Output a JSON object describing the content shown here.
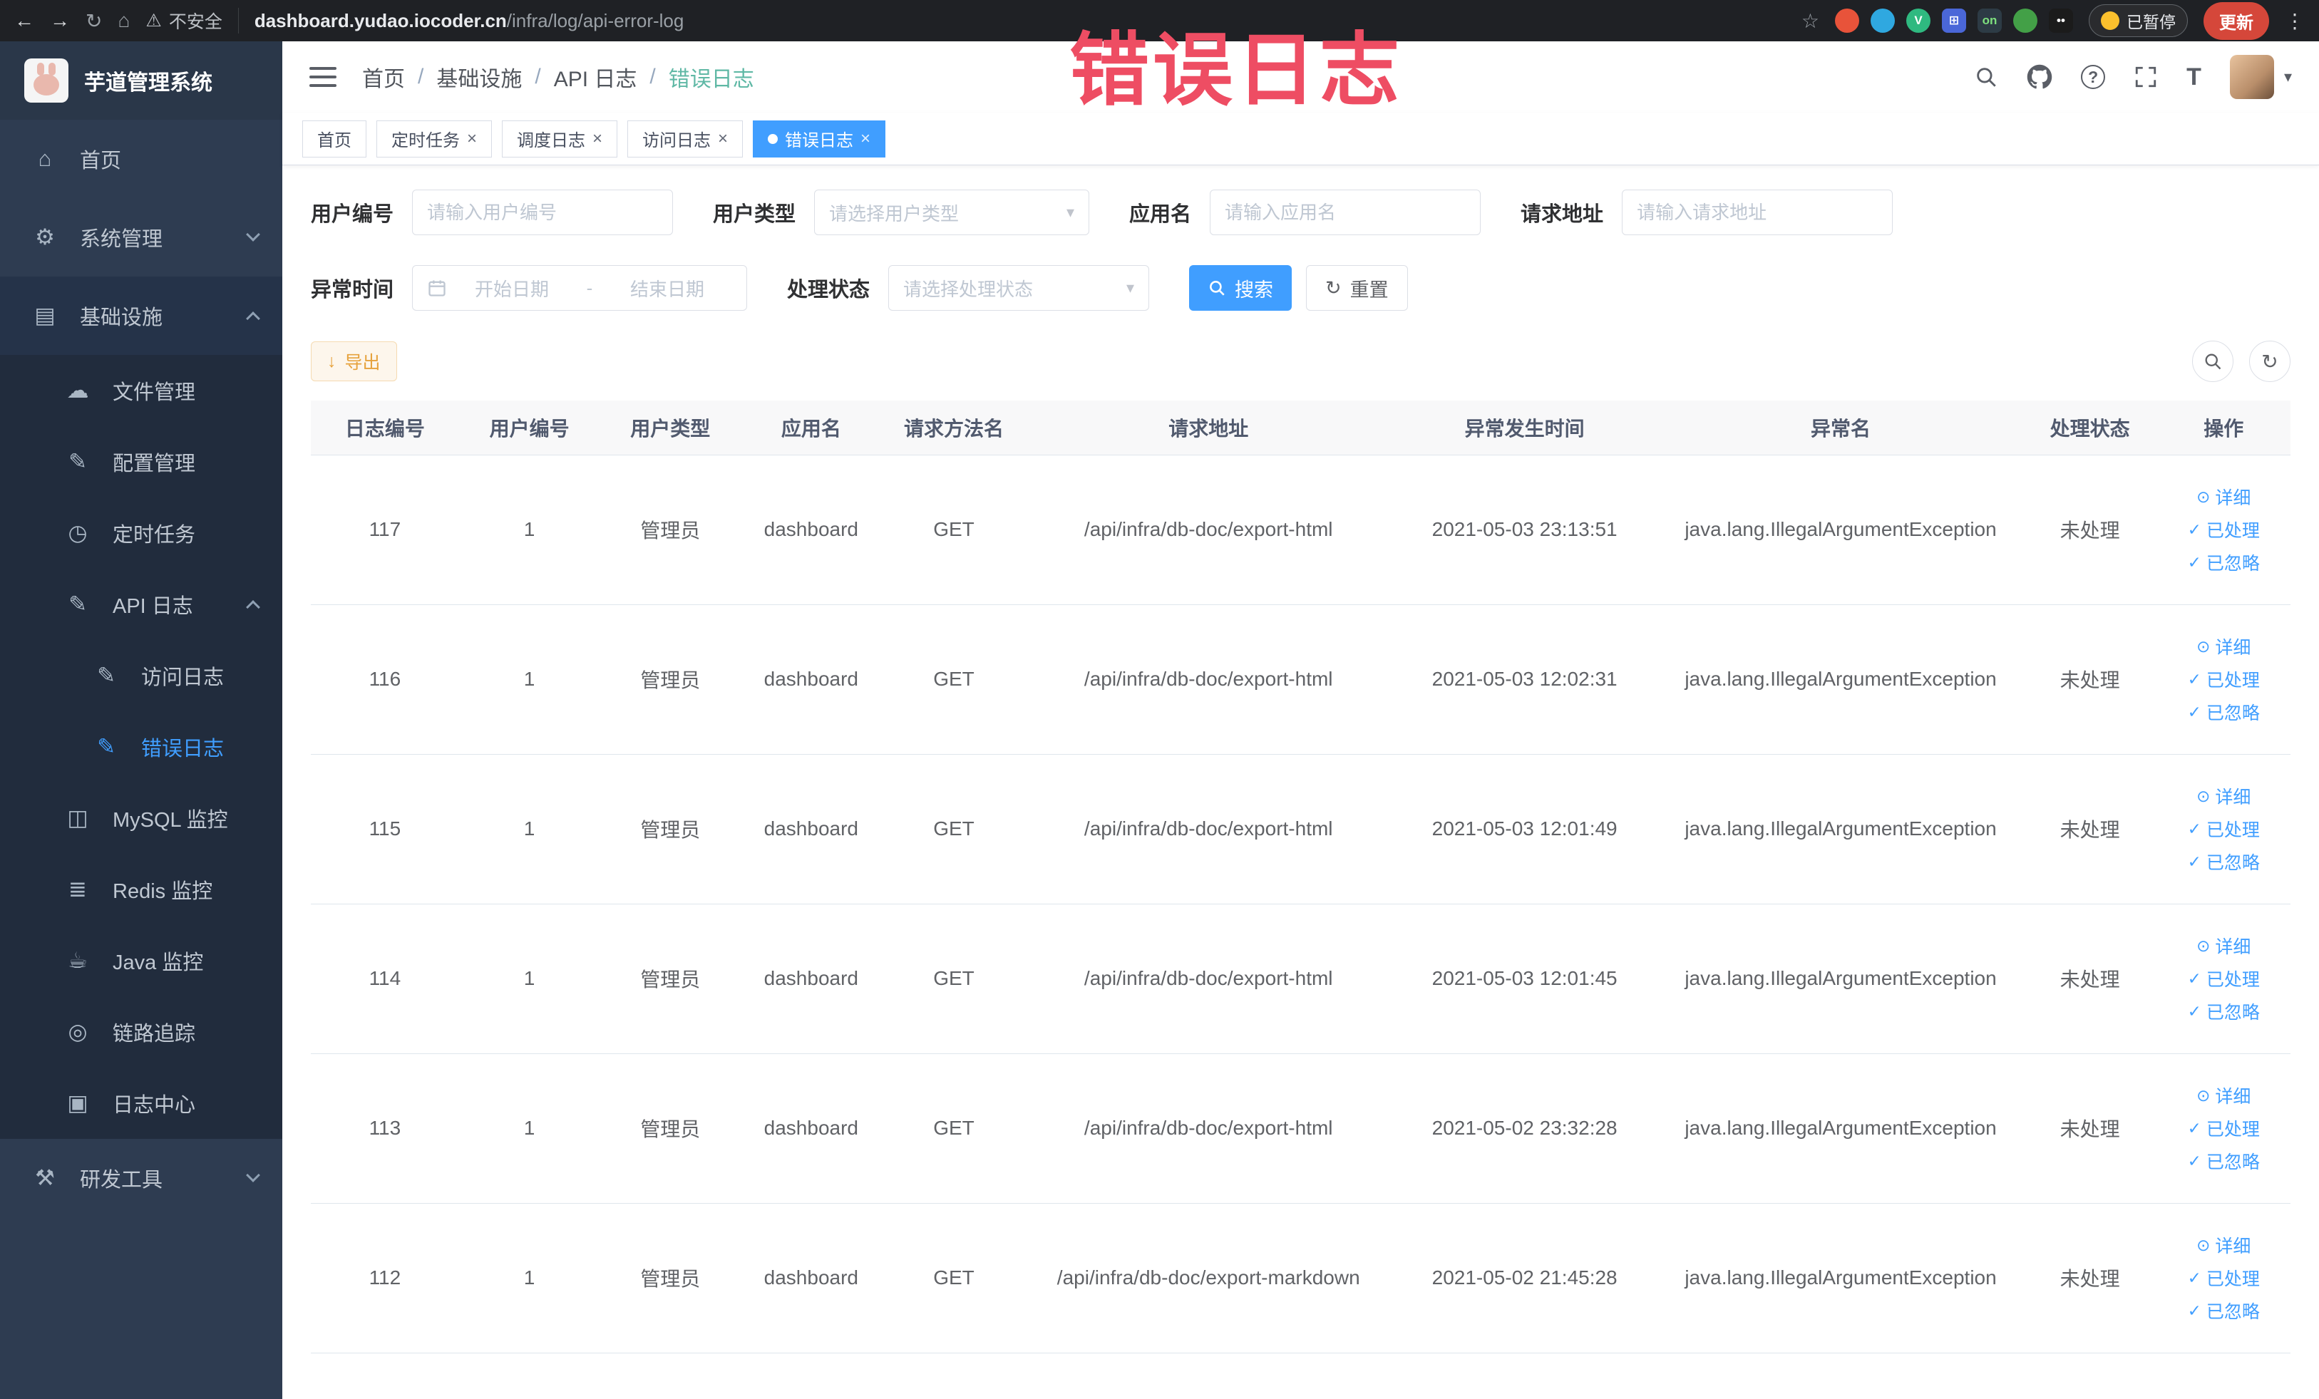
{
  "annotation": {
    "text": "错误日志"
  },
  "browser": {
    "security_label": "不安全",
    "url_domain": "dashboard.yudao.iocoder.cn",
    "url_path": "/infra/log/api-error-log",
    "paused_label": "已暂停",
    "update_label": "更新",
    "extensions": [
      {
        "name": "orange-extension-icon",
        "shape": "circle",
        "bg": "#e8533a",
        "glyph": ""
      },
      {
        "name": "water-drop-extension-icon",
        "shape": "circle",
        "bg": "#2fa8e0",
        "glyph": ""
      },
      {
        "name": "vue-devtools-extension-icon",
        "shape": "circle",
        "bg": "#2fb980",
        "glyph": "V"
      },
      {
        "name": "grid-extension-icon",
        "shape": "square",
        "bg": "#4a67d8",
        "glyph": "⊞"
      },
      {
        "name": "switchy-on-extension-icon",
        "shape": "square",
        "bg": "#2d3b45",
        "glyph": "on",
        "glyph_color": "#7ee07e"
      },
      {
        "name": "leaf-extension-icon",
        "shape": "circle",
        "bg": "#43a047",
        "glyph": ""
      },
      {
        "name": "tampermonkey-extension-icon",
        "shape": "square",
        "bg": "#1b1b1b",
        "glyph": "••"
      }
    ]
  },
  "sidebar": {
    "title": "芋道管理系统",
    "items": [
      {
        "key": "home",
        "label": "首页",
        "icon": "home",
        "level": 1
      },
      {
        "key": "system",
        "label": "系统管理",
        "icon": "gear",
        "level": 1,
        "arrow": "down"
      },
      {
        "key": "infra",
        "label": "基础设施",
        "icon": "infra",
        "level": 1,
        "arrow": "up",
        "open": true
      },
      {
        "key": "file",
        "label": "文件管理",
        "icon": "cloud",
        "level": 2
      },
      {
        "key": "config",
        "label": "配置管理",
        "icon": "edit",
        "level": 2
      },
      {
        "key": "job",
        "label": "定时任务",
        "icon": "clock",
        "level": 2
      },
      {
        "key": "api-log",
        "label": "API 日志",
        "icon": "note",
        "level": 2,
        "arrow": "up",
        "open": true
      },
      {
        "key": "access-log",
        "label": "访问日志",
        "icon": "note",
        "level": 3
      },
      {
        "key": "error-log",
        "label": "错误日志",
        "icon": "note",
        "level": 3,
        "active": true
      },
      {
        "key": "mysql",
        "label": "MySQL 监控",
        "icon": "monitor",
        "level": 2
      },
      {
        "key": "redis",
        "label": "Redis 监控",
        "icon": "db",
        "level": 2
      },
      {
        "key": "java",
        "label": "Java 监控",
        "icon": "coffee",
        "level": 2
      },
      {
        "key": "trace",
        "label": "链路追踪",
        "icon": "eye",
        "level": 2
      },
      {
        "key": "log-center",
        "label": "日志中心",
        "icon": "logcenter",
        "level": 2
      },
      {
        "key": "devtools",
        "label": "研发工具",
        "icon": "tools",
        "level": 1,
        "arrow": "down"
      }
    ]
  },
  "icons": {
    "back": "←",
    "forward": "→",
    "reload": "↻",
    "home": "⌂",
    "warning": "⚠",
    "star": "☆",
    "kebab": "⋮",
    "gear": "⚙",
    "infra": "▤",
    "cloud": "☁",
    "edit": "✎",
    "clock": "◷",
    "note": "✎",
    "monitor": "◫",
    "db": "≣",
    "coffee": "☕",
    "eye": "◎",
    "logcenter": "▣",
    "tools": "⚒",
    "question": "?",
    "fontsize": "T",
    "eye-action": "⊙",
    "check": "✓",
    "download": "↓",
    "refresh": "↻",
    "close": "×"
  },
  "header": {
    "breadcrumb": [
      "首页",
      "基础设施",
      "API 日志",
      "错误日志"
    ]
  },
  "tabs": [
    {
      "label": "首页",
      "closable": false,
      "active": false
    },
    {
      "label": "定时任务",
      "closable": true,
      "active": false
    },
    {
      "label": "调度日志",
      "closable": true,
      "active": false
    },
    {
      "label": "访问日志",
      "closable": true,
      "active": false
    },
    {
      "label": "错误日志",
      "closable": true,
      "active": true
    }
  ],
  "filters": {
    "user_id_label": "用户编号",
    "user_id_placeholder": "请输入用户编号",
    "user_type_label": "用户类型",
    "user_type_placeholder": "请选择用户类型",
    "app_name_label": "应用名",
    "app_name_placeholder": "请输入应用名",
    "request_url_label": "请求地址",
    "request_url_placeholder": "请输入请求地址",
    "time_label": "异常时间",
    "time_start_placeholder": "开始日期",
    "time_separator": "-",
    "time_end_placeholder": "结束日期",
    "status_label": "处理状态",
    "status_placeholder": "请选择处理状态",
    "search_label": "搜索",
    "reset_label": "重置"
  },
  "toolbar": {
    "export_label": "导出"
  },
  "table": {
    "columns": [
      "日志编号",
      "用户编号",
      "用户类型",
      "应用名",
      "请求方法名",
      "请求地址",
      "异常发生时间",
      "异常名",
      "处理状态",
      "操作"
    ],
    "rows": [
      [
        "117",
        "1",
        "管理员",
        "dashboard",
        "GET",
        "/api/infra/db-doc/export-html",
        "2021-05-03 23:13:51",
        "java.lang.IllegalArgumentException",
        "未处理"
      ],
      [
        "116",
        "1",
        "管理员",
        "dashboard",
        "GET",
        "/api/infra/db-doc/export-html",
        "2021-05-03 12:02:31",
        "java.lang.IllegalArgumentException",
        "未处理"
      ],
      [
        "115",
        "1",
        "管理员",
        "dashboard",
        "GET",
        "/api/infra/db-doc/export-html",
        "2021-05-03 12:01:49",
        "java.lang.IllegalArgumentException",
        "未处理"
      ],
      [
        "114",
        "1",
        "管理员",
        "dashboard",
        "GET",
        "/api/infra/db-doc/export-html",
        "2021-05-03 12:01:45",
        "java.lang.IllegalArgumentException",
        "未处理"
      ],
      [
        "113",
        "1",
        "管理员",
        "dashboard",
        "GET",
        "/api/infra/db-doc/export-html",
        "2021-05-02 23:32:28",
        "java.lang.IllegalArgumentException",
        "未处理"
      ],
      [
        "112",
        "1",
        "管理员",
        "dashboard",
        "GET",
        "/api/infra/db-doc/export-markdown",
        "2021-05-02 21:45:28",
        "java.lang.IllegalArgumentException",
        "未处理"
      ]
    ],
    "row_actions": [
      {
        "label": "详细",
        "icon": "eye-action"
      },
      {
        "label": "已处理",
        "icon": "check"
      },
      {
        "label": "已忽略",
        "icon": "check"
      }
    ]
  }
}
